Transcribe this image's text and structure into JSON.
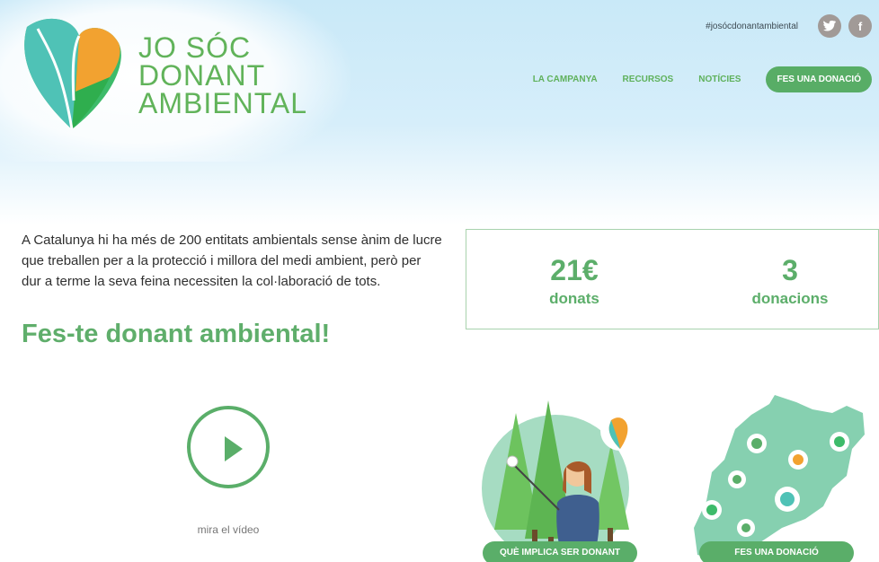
{
  "brand": {
    "line1": "JO SÓC",
    "line2": "DONANT",
    "line3": "AMBIENTAL"
  },
  "social": {
    "hashtag": "#josócdonantambiental",
    "twitter_glyph": "🐦",
    "facebook_glyph": "f"
  },
  "nav": {
    "items": [
      "LA CAMPANYA",
      "RECURSOS",
      "NOTÍCIES"
    ],
    "cta": "FES UNA DONACIÓ"
  },
  "intro": {
    "text": "A Catalunya hi ha més de 200 entitats ambientals sense ànim de lucre que treballen per a la protecció i millora del medi ambient, però per dur a terme la seva feina necessiten la col·laboració de tots.",
    "headline": "Fes-te donant ambiental!"
  },
  "stats": {
    "donated_value": "21€",
    "donated_label": "donats",
    "count_value": "3",
    "count_label": "donacions"
  },
  "video": {
    "label": "mira el vídeo"
  },
  "cards": {
    "implica_button": "QUÈ IMPLICA SER DONANT",
    "donacio_button": "FES UNA DONACIÓ"
  },
  "colors": {
    "brand_green": "#5fb15c",
    "button_green": "#58ad66",
    "sky_blue": "#c9e9f8",
    "social_grey": "#a19a97"
  },
  "icons": [
    "logo-heart-icon",
    "twitter-icon",
    "facebook-icon",
    "play-icon",
    "location-pin-icon"
  ]
}
